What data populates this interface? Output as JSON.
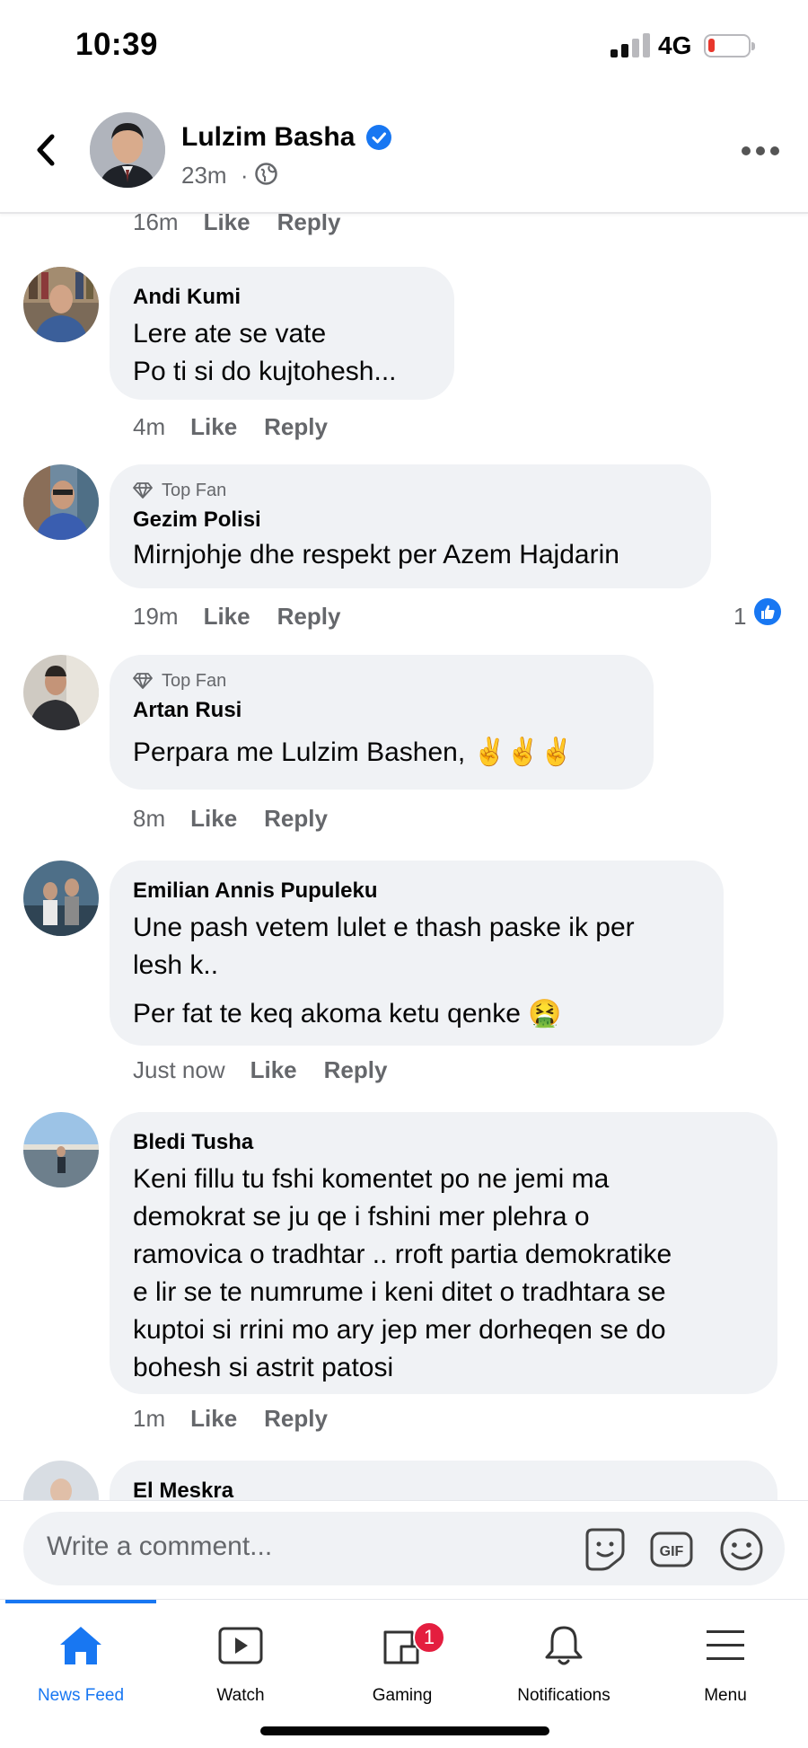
{
  "status_bar": {
    "time": "10:39",
    "network": "4G"
  },
  "post_header": {
    "name": "Lulzim Basha",
    "time": "23m",
    "separator": "·"
  },
  "labels": {
    "like": "Like",
    "reply": "Reply",
    "top_fan": "Top Fan"
  },
  "previous_comment": {
    "time": "16m"
  },
  "comments": [
    {
      "author": "Andi Kumi",
      "lines": [
        "Lere ate se vate",
        "Po ti si do kujtohesh..."
      ],
      "time": "4m",
      "top_fan": false
    },
    {
      "author": "Gezim Polisi",
      "lines": [
        "Mirnjohje dhe respekt per Azem Hajdarin"
      ],
      "time": "19m",
      "top_fan": true,
      "reactions": "1"
    },
    {
      "author": "Artan Rusi",
      "lines": [
        "Perpara me Lulzim Bashen, ✌️✌️✌️"
      ],
      "time": "8m",
      "top_fan": true
    },
    {
      "author": "Emilian Annis Pupuleku",
      "lines": [
        "Une pash vetem lulet e thash paske ik per",
        "lesh k..",
        "Per fat te keq akoma ketu qenke 🤮"
      ],
      "time": "Just now",
      "top_fan": false
    },
    {
      "author": "Bledi Tusha",
      "lines": [
        "Keni fillu tu fshi komentet po ne jemi ma",
        "demokrat se ju qe i fshini mer plehra o",
        "ramovica o tradhtar .. rroft partia demokratike",
        "e lir se te numrume i keni ditet o tradhtara se",
        "kuptoi si rrini mo ary jep mer dorheqen se do",
        "bohesh si astrit patosi"
      ],
      "time": "1m",
      "top_fan": false
    },
    {
      "author": "El Meskra",
      "lines": [],
      "time": "",
      "top_fan": false
    }
  ],
  "composer": {
    "placeholder": "Write a comment..."
  },
  "tabs": [
    {
      "label": "News Feed",
      "icon": "home-icon",
      "active": true
    },
    {
      "label": "Watch",
      "icon": "watch-icon",
      "active": false
    },
    {
      "label": "Gaming",
      "icon": "gaming-icon",
      "active": false,
      "badge": "1"
    },
    {
      "label": "Notifications",
      "icon": "bell-icon",
      "active": false
    },
    {
      "label": "Menu",
      "icon": "menu-icon",
      "active": false
    }
  ],
  "colors": {
    "accent": "#1877f2",
    "bubble": "#f0f2f5",
    "secondary_text": "#65676b",
    "badge": "#e41e3f",
    "battery_low": "#e8372c"
  }
}
